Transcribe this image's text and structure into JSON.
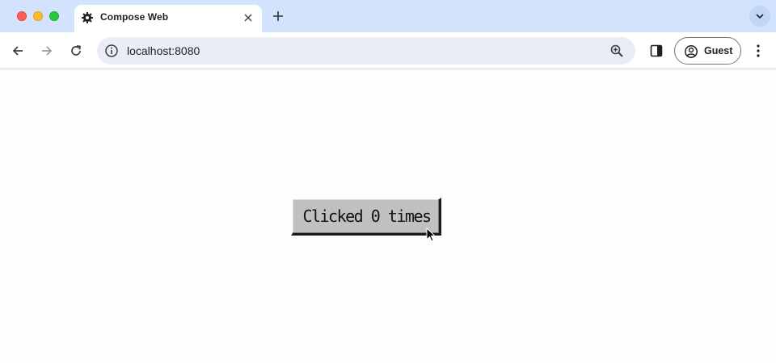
{
  "browser": {
    "tab": {
      "title": "Compose Web",
      "favicon": "compose-gear-icon"
    },
    "address_bar": {
      "url": "localhost:8080"
    },
    "profile": {
      "label": "Guest"
    },
    "icons": {
      "back": "arrow-left-icon",
      "forward": "arrow-right-icon",
      "reload": "reload-icon",
      "site_info": "info-icon",
      "zoom": "zoom-icon",
      "side_panel": "side-panel-icon",
      "menu": "three-dots-vertical-icon",
      "new_tab": "plus-icon",
      "close_tab": "close-icon",
      "tab_search": "chevron-down-icon"
    }
  },
  "page": {
    "button": {
      "label": "Clicked 0 times"
    }
  },
  "colors": {
    "titlebar": "#d3e3fd",
    "omnibox": "#e9eef6",
    "button_face": "#c0c0c0",
    "page_background": "#fdfdfd"
  }
}
